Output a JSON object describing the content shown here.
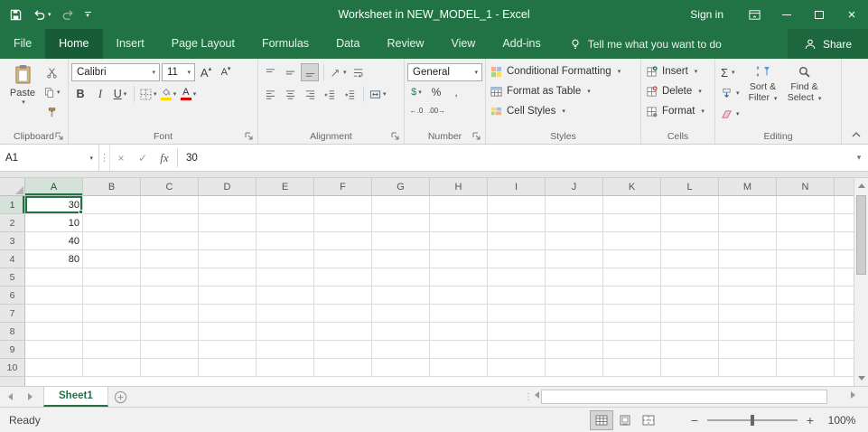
{
  "theme": {
    "accent": "#217346",
    "accent_dark": "#185C37",
    "fill_yellow": "#FFD800",
    "font_red": "#E00000"
  },
  "title_bar": {
    "title": "Worksheet in NEW_MODEL_1 - Excel",
    "sign_in_label": "Sign in"
  },
  "ribbon_tabs": {
    "items": [
      {
        "label": "File",
        "active": false
      },
      {
        "label": "Home",
        "active": true
      },
      {
        "label": "Insert",
        "active": false
      },
      {
        "label": "Page Layout",
        "active": false
      },
      {
        "label": "Formulas",
        "active": false
      },
      {
        "label": "Data",
        "active": false
      },
      {
        "label": "Review",
        "active": false
      },
      {
        "label": "View",
        "active": false
      },
      {
        "label": "Add-ins",
        "active": false
      }
    ],
    "tell_me_label": "Tell me what you want to do",
    "share_label": "Share"
  },
  "ribbon": {
    "clipboard": {
      "group_label": "Clipboard",
      "paste_label": "Paste"
    },
    "font": {
      "group_label": "Font",
      "font_name": "Calibri",
      "font_size": "11",
      "bold_label": "B",
      "italic_label": "I",
      "underline_label": "U"
    },
    "alignment": {
      "group_label": "Alignment"
    },
    "number": {
      "group_label": "Number",
      "format_value": "General",
      "accounting_label": "$",
      "percent_label": "%",
      "comma_label": ",",
      "increase_decimal_label": "←.0",
      "decrease_decimal_label": ".00→"
    },
    "styles": {
      "group_label": "Styles",
      "conditional_formatting_label": "Conditional Formatting",
      "format_as_table_label": "Format as Table",
      "cell_styles_label": "Cell Styles"
    },
    "cells": {
      "group_label": "Cells",
      "insert_label": "Insert",
      "delete_label": "Delete",
      "format_label": "Format"
    },
    "editing": {
      "group_label": "Editing",
      "autosum_label": "Σ",
      "sort_filter_label": "Sort & Filter",
      "find_select_label": "Find & Select"
    }
  },
  "formula_bar": {
    "name_box_value": "A1",
    "fx_label": "fx",
    "value": "30"
  },
  "grid": {
    "columns": [
      "A",
      "B",
      "C",
      "D",
      "E",
      "F",
      "G",
      "H",
      "I",
      "J",
      "K",
      "L",
      "M",
      "N"
    ],
    "row_count": 10,
    "cells": {
      "A1": "30",
      "A2": "10",
      "A3": "40",
      "A4": "80"
    },
    "selected_cell": "A1"
  },
  "sheet_bar": {
    "tabs": [
      {
        "label": "Sheet1",
        "active": true
      }
    ]
  },
  "status_bar": {
    "status_label": "Ready",
    "zoom_label": "100%"
  }
}
